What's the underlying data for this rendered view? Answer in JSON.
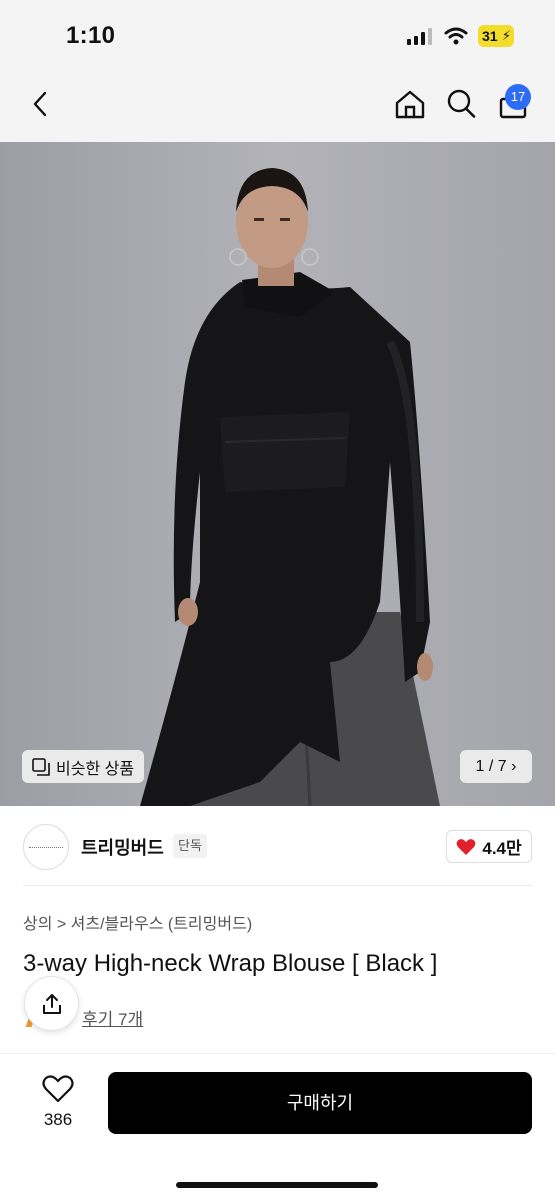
{
  "status": {
    "time": "1:10",
    "battery": "31"
  },
  "nav": {
    "cart_count": "17"
  },
  "gallery": {
    "similar_label": "비슷한 상품",
    "page_indicator": "1 / 7",
    "chevron": "›"
  },
  "brand": {
    "name": "트리밍버드",
    "tag": "단독",
    "likes": "4.4만"
  },
  "product": {
    "breadcrumb": "상의 > 셔츠/블라우스 (트리밍버드)",
    "title": "3-way High-neck Wrap Blouse [ Black ]",
    "reviews": "후기 7개"
  },
  "bottom": {
    "wish_count": "386",
    "buy_label": "구매하기"
  },
  "colors": {
    "accent": "#2d6df6",
    "heart": "#e0202a",
    "battery": "#f3dc2a"
  }
}
